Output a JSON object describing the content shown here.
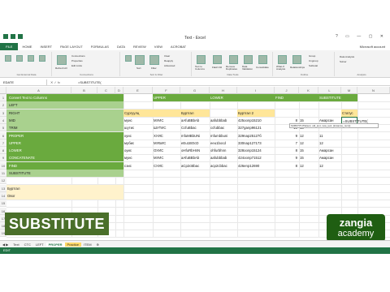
{
  "app": {
    "title": "Text - Excel"
  },
  "ribbon_tabs": [
    "FILE",
    "HOME",
    "INSERT",
    "PAGE LAYOUT",
    "FORMULAS",
    "DATA",
    "REVIEW",
    "VIEW",
    "ACROBAT"
  ],
  "user": "Microsoft account",
  "ribbon_groups": [
    "Get External Data",
    "Connections",
    "Sort & Filter",
    "Data Tools",
    "Outline",
    "Analysis"
  ],
  "ribbon_buttons": {
    "refresh": "Refresh All",
    "connections": "Connections",
    "properties": "Properties",
    "edit_links": "Edit Links",
    "sort": "Sort",
    "filter": "Filter",
    "clear": "Clear",
    "reapply": "Reapply",
    "advanced": "Advanced",
    "text_to_columns": "Text to Columns",
    "flash_fill": "Flash Fill",
    "remove_duplicates": "Remove Duplicates",
    "data_validation": "Data Validation",
    "consolidate": "Consolidate",
    "what_if": "What-If Analysis",
    "relationships": "Relationships",
    "group": "Group",
    "ungroup": "Ungroup",
    "subtotal": "Subtotal",
    "data_analysis": "Data Analysis",
    "solver": "Solver"
  },
  "name_box": "EDATE",
  "formula_bar": "=SUBSTITUTE(",
  "columns": [
    "A",
    "B",
    "C",
    "D",
    "E",
    "F",
    "G",
    "H",
    "I",
    "J",
    "K",
    "L",
    "M",
    "N"
  ],
  "rows": [
    "1",
    "2",
    "3",
    "4",
    "5",
    "6",
    "7",
    "8",
    "9",
    "10",
    "11",
    "12",
    "13",
    "14",
    "15",
    "16",
    "17",
    "18",
    "19"
  ],
  "menu_list": [
    "Convert Text to Columns",
    "LEFT",
    "RIGHT",
    "MID",
    "TRIM",
    "PROPER",
    "UPPER",
    "LOWER",
    "CONCATENATE",
    "FIND",
    "SUBSTITUTE"
  ],
  "headers": {
    "upper": "UPPER",
    "lower": "LOWER",
    "find": "FIND",
    "substitute": "SUBSTITUTE"
  },
  "row2": {
    "col_e": "Сургуулц",
    "col_g": "Буртгал",
    "col_i": "Буртгал 2",
    "col_m": "Статус"
  },
  "table": [
    {
      "e": "муис",
      "f": "МУИС",
      "g": "aAfuBBbAb",
      "h": "aafubbbab",
      "i": "425oonp15210",
      "j": "8",
      "k": "15",
      "l": "Амарсан",
      "m": "=SUBSTITUTE("
    },
    {
      "e": "шутис",
      "f": "ШУТИС",
      "g": "CcfuBbac",
      "h": "ccfubbac",
      "i": "327ganp96121",
      "j": "10",
      "k": "15",
      "l": "",
      "m": ""
    },
    {
      "e": "хуис",
      "f": "ХУИС",
      "g": "mfuMBbUNi",
      "h": "mfumbbuni",
      "i": "329nap25127б",
      "j": "9",
      "k": "12",
      "l": "11",
      "m": ""
    },
    {
      "e": "мубис",
      "f": "МУБИС",
      "g": "eEu1BOcD",
      "h": "eeu1bocd",
      "i": "330nap127173",
      "j": "7",
      "k": "12",
      "l": "12",
      "m": ""
    },
    {
      "e": "оуис",
      "f": "ОУИС",
      "g": "oHfuRbHnN",
      "h": "ohfurbhnn",
      "i": "328oonp15124",
      "j": "8",
      "k": "15",
      "l": "Амарсан",
      "m": ""
    },
    {
      "e": "муис",
      "f": "МУИС",
      "g": "aAfuBBbAb",
      "h": "aafubbbab",
      "i": "424oonp71512",
      "j": "9",
      "k": "15",
      "l": "Амарсан",
      "m": ""
    },
    {
      "e": "сэис",
      "f": "СУИС",
      "g": "aCp2cBbac",
      "h": "acp2cbbac",
      "i": "426enp12690",
      "j": "8",
      "k": "12",
      "l": "12",
      "m": ""
    }
  ],
  "left_below": {
    "r13": "Буртгал",
    "r14": "Овог"
  },
  "tooltip": "SUBSTITUTE(text, old_text, new_text, [instance_num])",
  "sheet_tabs": [
    "Text",
    "CTC",
    "LEFT",
    "PROPER",
    "Practice",
    "ITEM"
  ],
  "status": "EDIT",
  "banner": "SUBSTITUTE",
  "logo": {
    "name": "zangia",
    "sub": "academy"
  },
  "colors": {
    "excel_green": "#217346",
    "header_green": "#6aaa3e",
    "light_green": "#a9d18e",
    "yellow": "#ffe699"
  }
}
